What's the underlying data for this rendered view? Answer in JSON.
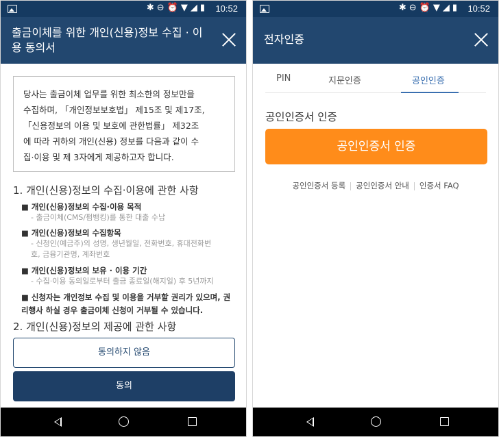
{
  "status_bar": {
    "time": "10:52",
    "icons": [
      "image-icon",
      "bluetooth-icon",
      "do-not-disturb-icon",
      "alarm-icon",
      "wifi-icon",
      "signal-icon",
      "battery-icon"
    ]
  },
  "left": {
    "header": {
      "title": "출금이체를 위한 개인(신용)정보 수집 · 이용 동의서"
    },
    "consent_box": {
      "lines": [
        "당사는 출금이체 업무를 위한 최소한의 정보만을",
        "수집하며, 「개인정보보호법」 제15조 및 제17조,",
        "「신용정보의 이용 및 보호에 관한법률」 제32조",
        "에 따라 귀하의 개인(신용) 정보를 다음과 같이 수",
        "집·이용 및 제 3자에게 제공하고자 합니다."
      ]
    },
    "section1": {
      "title": "1. 개인(신용)정보의 수집·이용에 관한 사항"
    },
    "items": [
      {
        "head": "■ 개인(신용)정보의 수집·이용 목적",
        "sub": [
          "- 출금이체(CMS/펌뱅킹)를 통한 대출 수납"
        ]
      },
      {
        "head": "■ 개인(신용)정보의 수집항목",
        "sub": [
          "- 신청인(예금주)의 성명, 생년월일, 전화번호, 휴대전화번",
          "호, 금융기관명, 계좌번호"
        ]
      },
      {
        "head": "■ 개인(신용)정보의 보유 · 이용 기간",
        "sub": [
          "- 수집·이용 동의일로부터 출금 종료일(해지일) 후 5년까지"
        ]
      }
    ],
    "notice": [
      "■ 신청자는 개인정보 수집 및 이용을 거부할 권리가 있으며, 권",
      "리행사 하실 경우 출금이체 신청이 거부될 수 있습니다."
    ],
    "section2": {
      "title": "2. 개인(신용)정보의 제공에 관한 사항"
    },
    "buttons": {
      "disagree": "동의하지 않음",
      "agree": "동의"
    }
  },
  "right": {
    "header": {
      "title": "전자인증"
    },
    "tabs": [
      {
        "label": "PIN",
        "active": false
      },
      {
        "label": "지문인증",
        "active": false
      },
      {
        "label": "공인인증",
        "active": true
      }
    ],
    "cert_title": "공인인증서 인증",
    "cert_button": "공인인증서 인증",
    "links": [
      "공인인증서 등록",
      "공인인증서 안내",
      "인증서 FAQ"
    ]
  },
  "colors": {
    "header": "#22476f",
    "statusbar": "#153a61",
    "accent_tab": "#3a6fb0",
    "cert_button": "#ff8c1a",
    "agree_button": "#1e3f66"
  }
}
